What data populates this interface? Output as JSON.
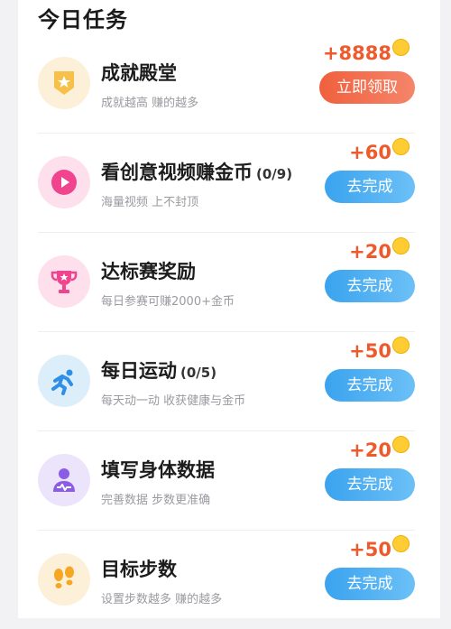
{
  "section_title": "今日任务",
  "coin_icon": "gold-coin-icon",
  "colors": {
    "reward": "#ee5a2c",
    "claim_button": "#f0603d",
    "go_button": "#3aa3ee"
  },
  "tasks": [
    {
      "icon": "trophy-medal-icon",
      "title": "成就殿堂",
      "progress": "",
      "subtitle": "成就越高 赚的越多",
      "reward": "+8888",
      "button": "立即领取"
    },
    {
      "icon": "play-video-icon",
      "title": "看创意视频赚金币",
      "progress": "(0/9)",
      "subtitle": "海量视频 上不封顶",
      "reward": "+60",
      "button": "去完成"
    },
    {
      "icon": "trophy-cup-icon",
      "title": "达标赛奖励",
      "progress": "",
      "subtitle": "每日参赛可赚2000+金币",
      "reward": "+20",
      "button": "去完成"
    },
    {
      "icon": "running-person-icon",
      "title": "每日运动",
      "progress": "(0/5)",
      "subtitle": "每天动一动 收获健康与金币",
      "reward": "+50",
      "button": "去完成"
    },
    {
      "icon": "body-data-icon",
      "title": "填写身体数据",
      "progress": "",
      "subtitle": "完善数据 步数更准确",
      "reward": "+20",
      "button": "去完成"
    },
    {
      "icon": "footprints-icon",
      "title": "目标步数",
      "progress": "",
      "subtitle": "设置步数越多 赚的越多",
      "reward": "+50",
      "button": "去完成"
    }
  ]
}
